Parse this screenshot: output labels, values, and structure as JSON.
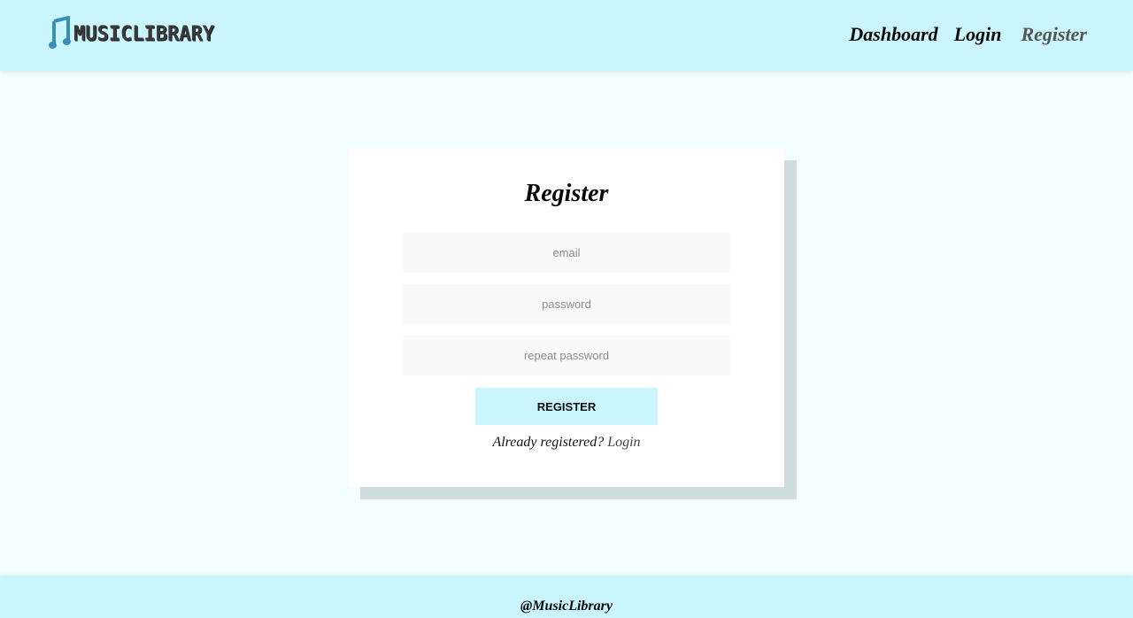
{
  "header": {
    "logo_text": "MUSICLIBRARY",
    "logo_icon": "music-note-icon",
    "nav": {
      "dashboard": "Dashboard",
      "login": "Login",
      "register": "Register"
    }
  },
  "register_form": {
    "title": "Register",
    "email_placeholder": "email",
    "email_value": "",
    "password_placeholder": "password",
    "password_value": "",
    "repeat_password_placeholder": "repeat password",
    "repeat_password_value": "",
    "submit_label": "REGISTER",
    "already_text": "Already registered?",
    "login_link": "Login"
  },
  "footer": {
    "text": "@MusicLibrary"
  },
  "colors": {
    "header_bg": "#caf5fd",
    "page_bg": "#f2feff",
    "button_bg": "#caf5fd",
    "card_shadow": "#cfdcdc",
    "logo_icon": "#3a8fb7"
  }
}
